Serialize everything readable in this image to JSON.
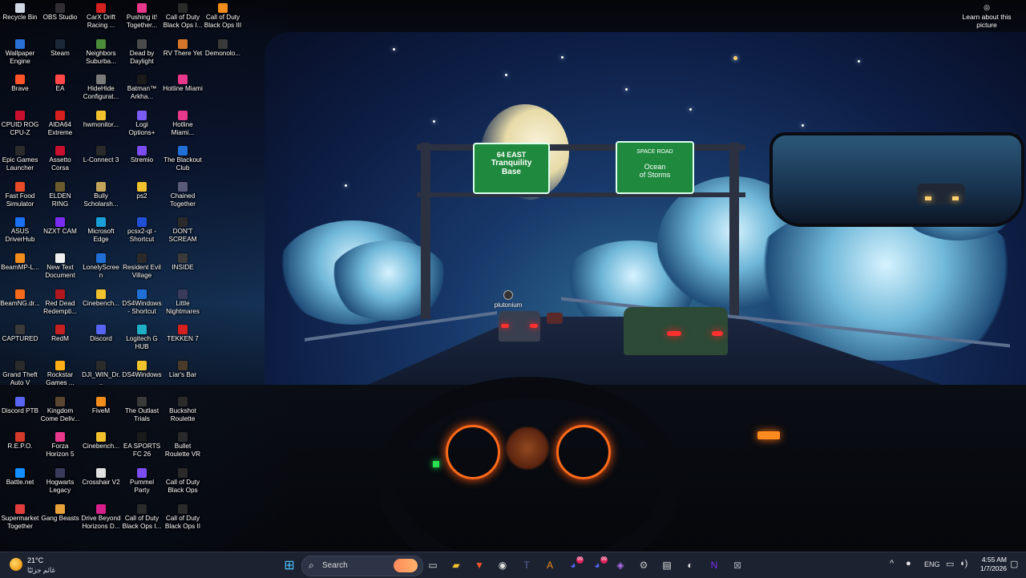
{
  "desktop": {
    "icons": [
      {
        "label": "Recycle Bin",
        "color": "#cfd8e6"
      },
      {
        "label": "Wallpaper Engine",
        "color": "#2a6fd6"
      },
      {
        "label": "Brave",
        "color": "#fb542b"
      },
      {
        "label": "CPUID ROG CPU-Z",
        "color": "#c8102e"
      },
      {
        "label": "Epic Games Launcher",
        "color": "#2b2b2b"
      },
      {
        "label": "Fast Food Simulator",
        "color": "#e84a27"
      },
      {
        "label": "ASUS DriverHub",
        "color": "#1b6ff2"
      },
      {
        "label": "BeamMP-L...",
        "color": "#f28c1a"
      },
      {
        "label": "BeamNG.dr...",
        "color": "#f26a1a"
      },
      {
        "label": "CAPTURED",
        "color": "#3a3a3a"
      },
      {
        "label": "Grand Theft Auto V",
        "color": "#2b2b2b"
      },
      {
        "label": "Discord PTB",
        "color": "#5865f2"
      },
      {
        "label": "R.E.P.O.",
        "color": "#d43a2a"
      },
      {
        "label": "Battle.net",
        "color": "#148eff"
      },
      {
        "label": "Supermarket Together",
        "color": "#e23d3d"
      },
      {
        "label": "OBS Studio",
        "color": "#302e31"
      },
      {
        "label": "Steam",
        "color": "#1b2838"
      },
      {
        "label": "EA",
        "color": "#ff4747"
      },
      {
        "label": "AIDA64 Extreme",
        "color": "#d61f1f"
      },
      {
        "label": "Assetto Corsa",
        "color": "#c8102e"
      },
      {
        "label": "ELDEN RING",
        "color": "#6b5a2e"
      },
      {
        "label": "NZXT CAM",
        "color": "#7b2cf2"
      },
      {
        "label": "New Text Document",
        "color": "#f0f0f0"
      },
      {
        "label": "Red Dead Redempti...",
        "color": "#b0171f"
      },
      {
        "label": "RedM",
        "color": "#c52020"
      },
      {
        "label": "Rockstar Games ...",
        "color": "#fcaf17"
      },
      {
        "label": "Kingdom Come Deliv...",
        "color": "#5a4630"
      },
      {
        "label": "Forza Horizon 5",
        "color": "#e8388b"
      },
      {
        "label": "Hogwarts Legacy",
        "color": "#3a3a5a"
      },
      {
        "label": "Gang Beasts",
        "color": "#e8a23a"
      },
      {
        "label": "CarX Drift Racing ...",
        "color": "#d61f1f"
      },
      {
        "label": "Neighbors Suburba...",
        "color": "#4a8c3a"
      },
      {
        "label": "HideHide Configurat...",
        "color": "#7a7a7a"
      },
      {
        "label": "hwmonitor...",
        "color": "#f2c12e"
      },
      {
        "label": "L-Connect 3",
        "color": "#2a2a2a"
      },
      {
        "label": "Bully Scholarsh...",
        "color": "#c4a35a"
      },
      {
        "label": "Microsoft Edge",
        "color": "#1aa0d8"
      },
      {
        "label": "LonelyScreen",
        "color": "#1f6fd6"
      },
      {
        "label": "Cinebench...",
        "color": "#f2c12e"
      },
      {
        "label": "Discord",
        "color": "#5865f2"
      },
      {
        "label": "DJI_WIN_Dr...",
        "color": "#2a2a2a"
      },
      {
        "label": "FiveM",
        "color": "#f28c1a"
      },
      {
        "label": "Cinebench...",
        "color": "#f2c12e"
      },
      {
        "label": "Crosshair V2",
        "color": "#e0e0e0"
      },
      {
        "label": "Drive Beyond Horizons D...",
        "color": "#d61f8a"
      },
      {
        "label": "Pushing it! Together...",
        "color": "#e8388b"
      },
      {
        "label": "Dead by Daylight",
        "color": "#4a4a4a"
      },
      {
        "label": "Batman™ Arkha...",
        "color": "#1a1a1a"
      },
      {
        "label": "Logi Options+",
        "color": "#7b5cf2"
      },
      {
        "label": "Stremio",
        "color": "#7b4cf2"
      },
      {
        "label": "ps2",
        "color": "#f2c12e"
      },
      {
        "label": "pcsx2-qt - Shortcut",
        "color": "#1f4fd6"
      },
      {
        "label": "Resident Evil Village",
        "color": "#2a2a2a"
      },
      {
        "label": "DS4Windows - Shortcut",
        "color": "#1f6fd6"
      },
      {
        "label": "Logitech G HUB",
        "color": "#1fb0c8"
      },
      {
        "label": "DS4Windows",
        "color": "#f2c12e"
      },
      {
        "label": "The Outlast Trials",
        "color": "#3a3a3a"
      },
      {
        "label": "EA SPORTS FC 26",
        "color": "#1a1a1a"
      },
      {
        "label": "Pummel Party",
        "color": "#7b4cf2"
      },
      {
        "label": "Call of Duty Black Ops I...",
        "color": "#2a2a2a"
      },
      {
        "label": "Call of Duty Black Ops I...",
        "color": "#2a2a2a"
      },
      {
        "label": "RV There Yet",
        "color": "#d6762a"
      },
      {
        "label": "Hotline Miami",
        "color": "#e8388b"
      },
      {
        "label": "Hotline Miami...",
        "color": "#e8388b"
      },
      {
        "label": "The Blackout Club",
        "color": "#1f6fd6"
      },
      {
        "label": "Chained Together",
        "color": "#5a5a7a"
      },
      {
        "label": "DON'T SCREAM",
        "color": "#2a2a2a"
      },
      {
        "label": "INSIDE",
        "color": "#3a3a3a"
      },
      {
        "label": "Little Nightmares",
        "color": "#3a3a5a"
      },
      {
        "label": "TEKKEN 7",
        "color": "#d61f1f"
      },
      {
        "label": "Liar's Bar",
        "color": "#4a3a2a"
      },
      {
        "label": "Buckshot Roulette",
        "color": "#2a2a2a"
      },
      {
        "label": "Bullet Roulette VR",
        "color": "#2a2a2a"
      },
      {
        "label": "Call of Duty Black Ops",
        "color": "#2a2a2a"
      },
      {
        "label": "Call of Duty Black Ops II",
        "color": "#2a2a2a"
      },
      {
        "label": "Call of Duty Black Ops III",
        "color": "#f28c1a"
      },
      {
        "label": "Demonolo...",
        "color": "#3a3a3a"
      }
    ],
    "plutonium_label": "plutonium",
    "learn_more": "Learn about this picture",
    "learn_more_icon": "camera-icon"
  },
  "wallpaper": {
    "sign_left_top": "64 EAST",
    "sign_left_line1": "Tranquility",
    "sign_left_line2": "Base",
    "sign_right_top": "SPACE ROAD",
    "sign_right_line1": "Ocean",
    "sign_right_line2": "of Storms"
  },
  "taskbar": {
    "weather_temp": "21°C",
    "weather_desc": "غائم جزئيًا",
    "search_placeholder": "Search",
    "apps": [
      {
        "name": "start-button",
        "glyph": "⊞",
        "color": "#4cc2ff"
      },
      {
        "name": "task-view-button",
        "glyph": "▭",
        "color": "#e0e0e0"
      },
      {
        "name": "file-explorer-button",
        "glyph": "▰",
        "color": "#f2c12e"
      },
      {
        "name": "brave-button",
        "glyph": "▼",
        "color": "#fb542b"
      },
      {
        "name": "obs-button",
        "glyph": "◉",
        "color": "#e0e0e0"
      },
      {
        "name": "teams-button",
        "glyph": "T",
        "color": "#6264a7"
      },
      {
        "name": "aida-button",
        "glyph": "A",
        "color": "#f28c1a"
      },
      {
        "name": "discord-ptb-button",
        "glyph": "◕",
        "color": "#5865f2",
        "badge": "99"
      },
      {
        "name": "discord-button",
        "glyph": "◕",
        "color": "#5865f2",
        "badge": "99"
      },
      {
        "name": "game-controller-button",
        "glyph": "◈",
        "color": "#b070f2"
      },
      {
        "name": "settings-button",
        "glyph": "⚙",
        "color": "#c0c0c0"
      },
      {
        "name": "terminal-button",
        "glyph": "▤",
        "color": "#e0e0e0"
      },
      {
        "name": "steam-button",
        "glyph": "◐",
        "color": "#e0e0e0"
      },
      {
        "name": "nzxt-button",
        "glyph": "N",
        "color": "#7b2cf2"
      },
      {
        "name": "xbox-button",
        "glyph": "⊠",
        "color": "#9aa0ad"
      }
    ],
    "tray": {
      "chevron": "^",
      "mic": "🎤",
      "lang": "ENG",
      "network": "▭",
      "volume": "🔊",
      "time": "4:55 AM",
      "date": "1/7/2026"
    }
  }
}
